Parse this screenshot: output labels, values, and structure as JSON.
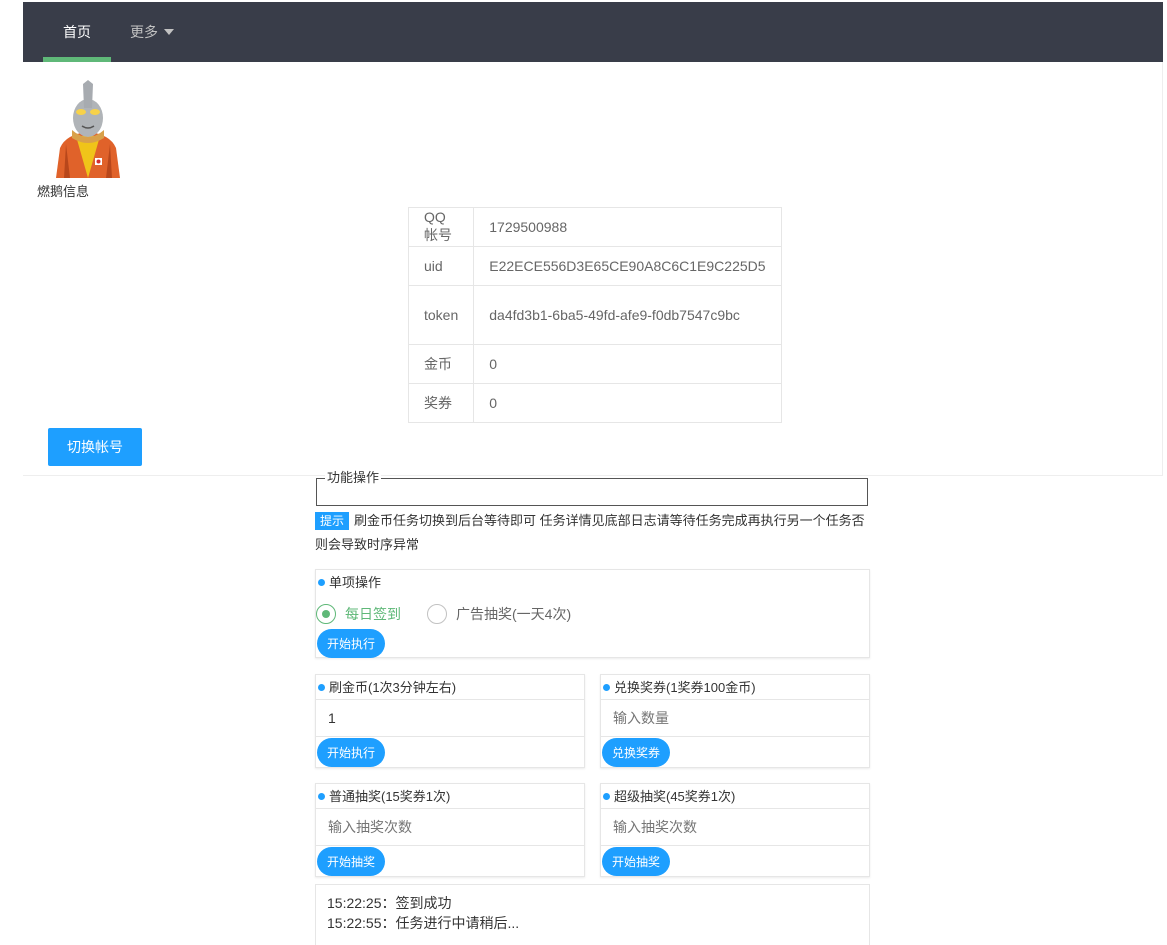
{
  "nav": {
    "home_label": "首页",
    "more_label": "更多"
  },
  "profile": {
    "avatar_icon": "avatar-image",
    "caption": "燃鹅信息",
    "rows": [
      {
        "key": "QQ帐号",
        "value": "1729500988"
      },
      {
        "key": "uid",
        "value": "E22ECE556D3E65CE90A8C6C1E9C225D5"
      },
      {
        "key": "token",
        "value": "da4fd3b1-6ba5-49fd-afe9-f0db7547c9bc"
      },
      {
        "key": "金币",
        "value": "0"
      },
      {
        "key": "奖券",
        "value": "0"
      }
    ],
    "switch_label": "切换帐号"
  },
  "functions": {
    "legend": "功能操作",
    "tip_badge": "提示",
    "tip_text": "刷金币任务切换到后台等待即可 任务详情见底部日志请等待任务完成再执行另一个任务否则会导致时序异常",
    "single": {
      "title": "单项操作",
      "options": [
        {
          "label": "每日签到",
          "selected": true
        },
        {
          "label": "广告抽奖(一天4次)",
          "selected": false
        }
      ],
      "button": "开始执行"
    },
    "coins": {
      "title": "刷金币(1次3分钟左右)",
      "value": "1",
      "button": "开始执行"
    },
    "exchange": {
      "title": "兑换奖券(1奖券100金币)",
      "placeholder": "输入数量",
      "button": "兑换奖券"
    },
    "normal_draw": {
      "title": "普通抽奖(15奖券1次)",
      "placeholder": "输入抽奖次数",
      "button": "开始抽奖"
    },
    "super_draw": {
      "title": "超级抽奖(45奖券1次)",
      "placeholder": "输入抽奖次数",
      "button": "开始抽奖"
    }
  },
  "log": [
    "15:22:25：签到成功",
    "15:22:55：任务进行中请稍后..."
  ],
  "colors": {
    "nav_bg": "#393d49",
    "accent_green": "#5fb878",
    "accent_blue": "#1e9fff"
  }
}
